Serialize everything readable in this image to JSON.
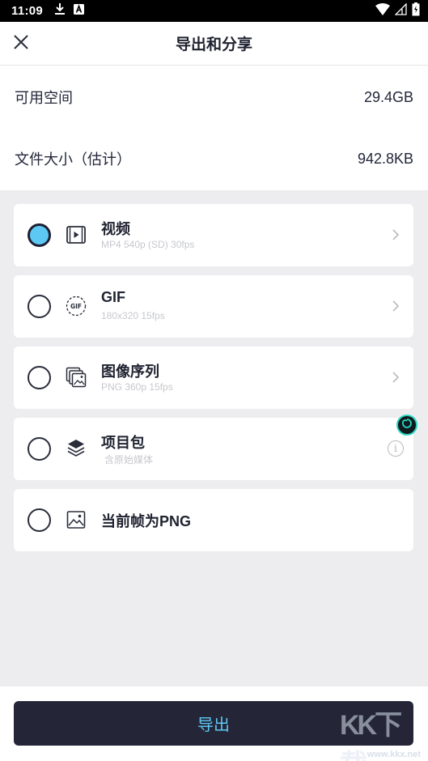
{
  "status_bar": {
    "time": "11:09"
  },
  "header": {
    "title": "导出和分享"
  },
  "info": {
    "available_label": "可用空间",
    "available_value": "29.4GB",
    "size_label": "文件大小（估计）",
    "size_value": "942.8KB"
  },
  "options": [
    {
      "label": "视频",
      "sub": "MP4 540p (SD) 30fps",
      "icon": "video-icon",
      "selected": true,
      "trailing": "chevron"
    },
    {
      "label": "GIF",
      "sub": "180x320 15fps",
      "icon": "gif-icon",
      "selected": false,
      "trailing": "chevron"
    },
    {
      "label": "图像序列",
      "sub": "PNG 360p 15fps",
      "icon": "image-sequence-icon",
      "selected": false,
      "trailing": "chevron"
    },
    {
      "label": "项目包",
      "sub": "含原始媒体",
      "icon": "layers-icon",
      "selected": false,
      "trailing": "info"
    },
    {
      "label": "当前帧为PNG",
      "sub": "",
      "icon": "image-icon",
      "selected": false,
      "trailing": "none"
    }
  ],
  "info_glyph": "i",
  "export_label": "导出",
  "watermark": {
    "logo": "KK下载",
    "text": "www.kkx.net"
  },
  "colors": {
    "accent": "#5ec8f5",
    "dark": "#242638",
    "background": "#ededf0"
  }
}
